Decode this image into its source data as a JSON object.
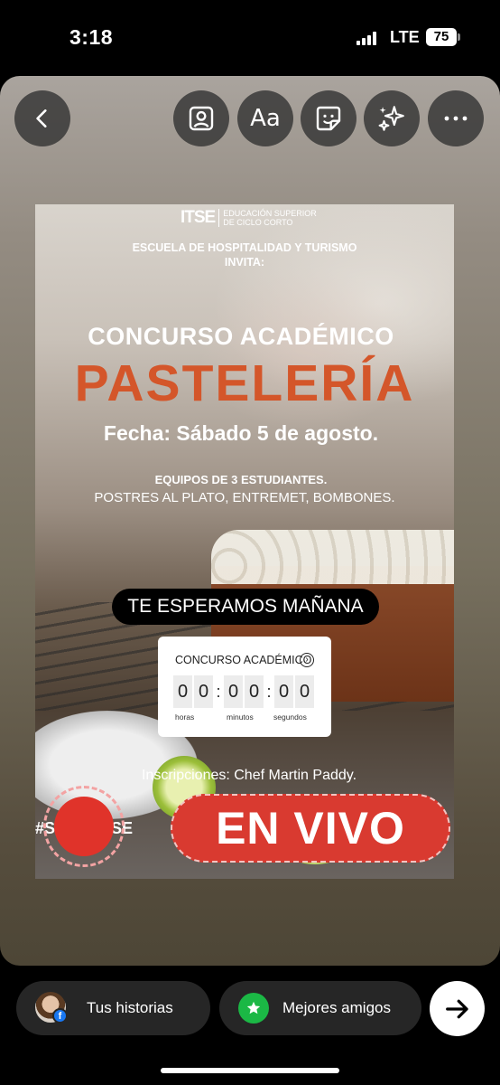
{
  "status_bar": {
    "time": "3:18",
    "network": "LTE",
    "battery": "75"
  },
  "toolbar": {
    "back_icon": "chevron-left-icon",
    "text_tool_label": "Aa",
    "icons": [
      "person-frame-icon",
      "text-icon",
      "sticker-icon",
      "sparkles-icon",
      "more-icon"
    ]
  },
  "story": {
    "logo_mark": "ITSE",
    "logo_line1": "EDUCACIÓN SUPERIOR",
    "logo_line2": "DE CICLO CORTO",
    "school_line1": "ESCUELA DE HOSPITALIDAD Y TURISMO",
    "school_line2": "INVITA:",
    "contest_title": "CONCURSO ACADÉMICO",
    "headline": "PASTELERÍA",
    "date": "Fecha: Sábado 5 de agosto.",
    "teams": "EQUIPOS DE 3 ESTUDIANTES.",
    "categories": "POSTRES AL PLATO, ENTREMET, BOMBONES.",
    "text_sticker": "TE ESPERAMOS MAÑANA",
    "countdown": {
      "title": "CONCURSO ACADÉMICO",
      "digits": [
        "0",
        "0",
        "0",
        "0",
        "0",
        "0"
      ],
      "labels": [
        "horas",
        "minutos",
        "segundos"
      ]
    },
    "registration": "Inscripciones: Chef Martin Paddy.",
    "hashtag_start": "#S",
    "hashtag_end": "SE",
    "live_sticker": "EN VIVO",
    "accent_color": "#d4562a",
    "live_color": "#d93a30"
  },
  "share_bar": {
    "your_story_label": "Tus historias",
    "close_friends_label": "Mejores amigos",
    "send_icon": "arrow-right-icon"
  }
}
